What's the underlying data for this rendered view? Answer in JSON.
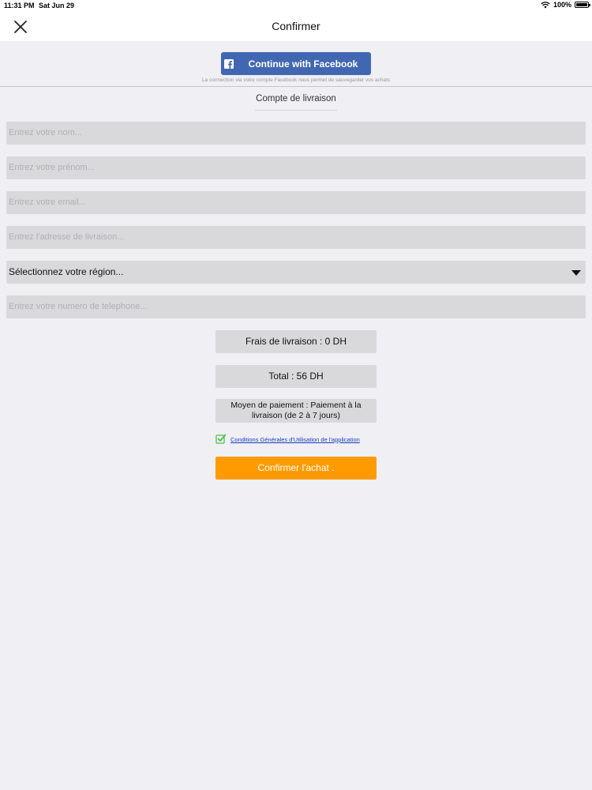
{
  "status_bar": {
    "time": "11:31 PM",
    "date": "Sat Jun 29",
    "battery_text": "100%",
    "battery_level": 1.0,
    "icons": [
      "wifi-icon",
      "battery-icon"
    ]
  },
  "nav": {
    "title": "Confirmer",
    "close_icon": "close-icon"
  },
  "facebook": {
    "button_label": "Continue with Facebook",
    "note": "La connection via votre compte Facebook nous permet de sauvegarder vos achats",
    "color": "#4267b2"
  },
  "section_label": "Compte de livraison",
  "form": {
    "name_placeholder": "Entrez votre nom...",
    "firstname_placeholder": "Entrez votre prénom...",
    "email_placeholder": "Entrez votre email...",
    "address_placeholder": "Entrez l'adresse de livraison...",
    "region_selected": "Sélectionnez votre région...",
    "phone_placeholder": "Entrez votre numero de telephone..."
  },
  "summary": {
    "shipping": "Frais de livraison : 0 DH",
    "total": "Total : 56 DH",
    "payment": "Moyen de paiement : Paiement à la livraison (de 2 à 7 jours)"
  },
  "terms": {
    "checked": true,
    "link_text": "Conditions Générales d'Utilisation de l'application",
    "check_color": "#4cc24c"
  },
  "confirm": {
    "label": "Confirmer l'achat .",
    "color": "#ff9b00"
  }
}
